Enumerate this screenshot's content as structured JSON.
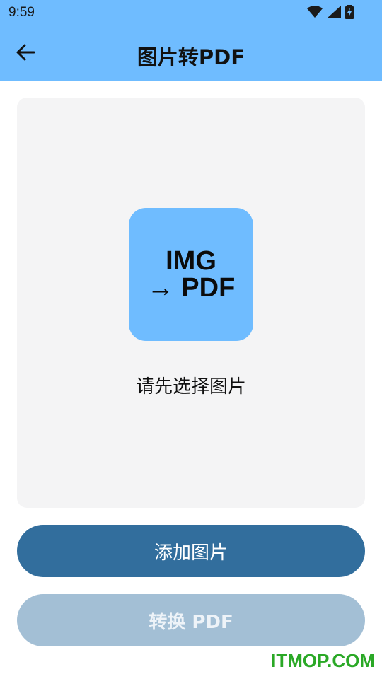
{
  "status_bar": {
    "time": "9:59",
    "icons": [
      "wifi-icon",
      "signal-icon",
      "battery-charging-icon"
    ]
  },
  "app_bar": {
    "back_icon": "arrow-left-icon",
    "title": "图片转PDF",
    "background": "#6fbcff"
  },
  "main": {
    "logo": {
      "line1": "IMG",
      "line2": "→ PDF"
    },
    "hint": "请先选择图片"
  },
  "buttons": {
    "add_label": "添加图片",
    "convert_label": "转换 PDF",
    "add_color": "#326e9d",
    "convert_color": "#a3bfd5"
  },
  "watermark": "ITMOP.COM"
}
